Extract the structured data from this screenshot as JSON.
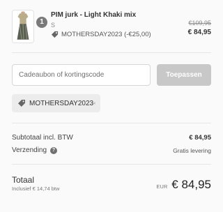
{
  "product": {
    "quantity": "1",
    "name": "PIM jurk - Light Khaki mix",
    "size": "S",
    "discount_line": "MOTHERSDAY2023 (-€25,00)",
    "original_price": "€109,95",
    "price": "€ 84,95",
    "thumbnail_icon": "dress-photo"
  },
  "discount": {
    "placeholder": "Cadeaubon of kortingscode",
    "apply_label": "Toepassen",
    "applied_code": "MOTHERSDAY2023"
  },
  "summary": {
    "subtotal_label": "Subtotaal incl. BTW",
    "subtotal_value": "€ 84,95",
    "shipping_label": "Verzending",
    "shipping_value": "Gratis levering"
  },
  "total": {
    "label": "Totaal",
    "tax_note": "Inclusief € 14,74 btw",
    "currency": "EUR",
    "amount": "€ 84,95"
  },
  "colors": {
    "button_disabled": "#c8c8c8",
    "chip_background": "#ececec",
    "page_background": "#fafafa"
  }
}
